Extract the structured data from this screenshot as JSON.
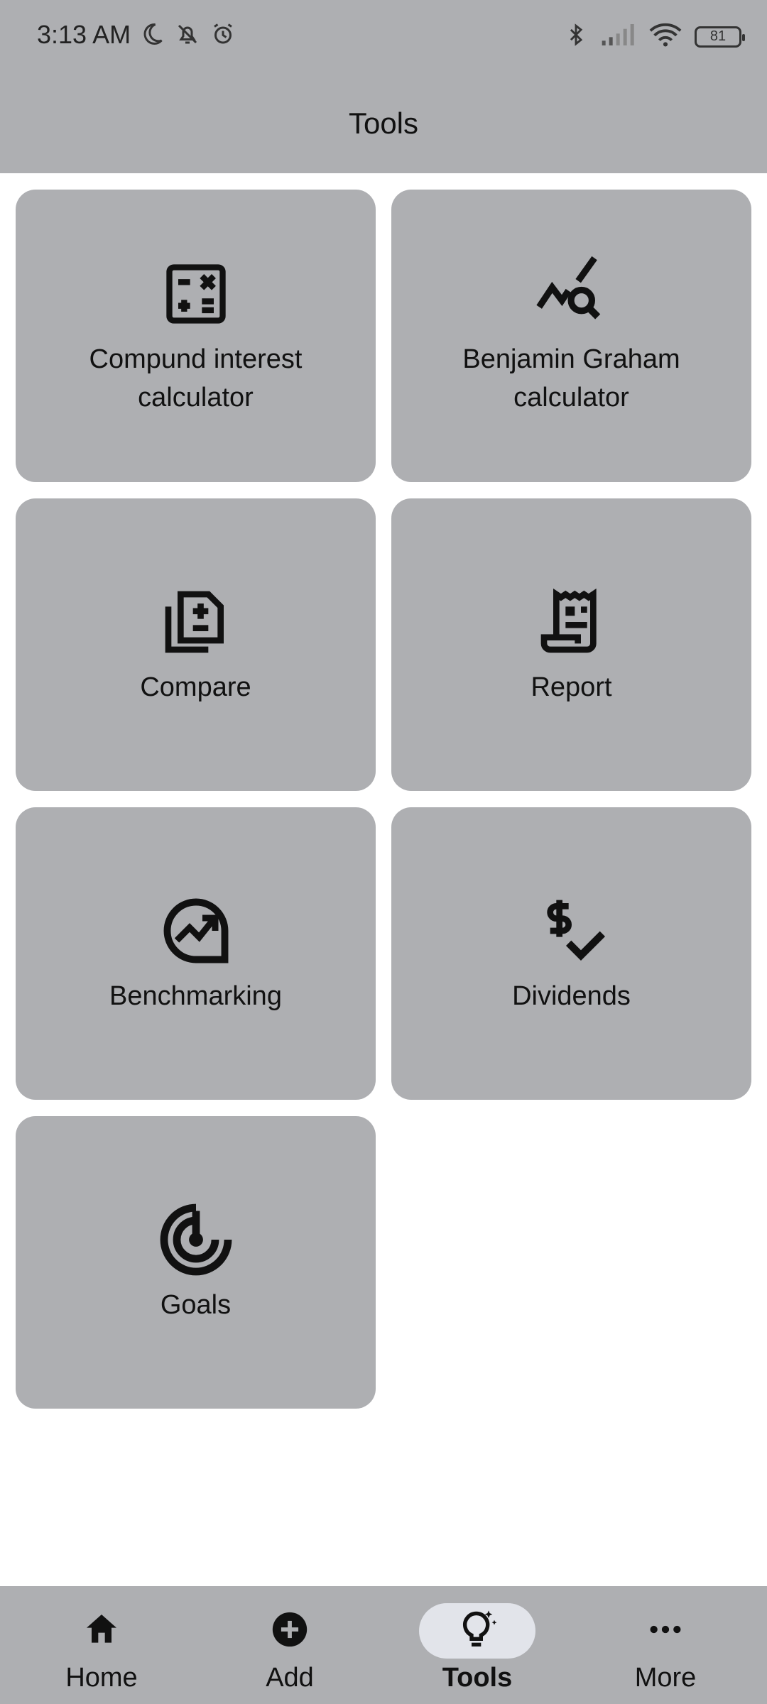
{
  "status_bar": {
    "time": "3:13 AM",
    "battery_level": "81",
    "left_icons": [
      "moon-icon",
      "bell-off-icon",
      "alarm-icon"
    ],
    "right_icons": [
      "bluetooth-icon",
      "signal-icon",
      "wifi-icon",
      "battery-icon"
    ]
  },
  "app_bar": {
    "title": "Tools"
  },
  "tools": [
    {
      "label": "Compund interest calculator",
      "icon": "calculator-icon"
    },
    {
      "label": "Benjamin Graham calculator",
      "icon": "chart-search-icon"
    },
    {
      "label": "Compare",
      "icon": "compare-icon"
    },
    {
      "label": "Report",
      "icon": "receipt-icon"
    },
    {
      "label": "Benchmarking",
      "icon": "benchmark-icon"
    },
    {
      "label": "Dividends",
      "icon": "dividends-icon"
    },
    {
      "label": "Goals",
      "icon": "target-icon"
    }
  ],
  "bottom_nav": {
    "items": [
      {
        "label": "Home",
        "icon": "home-icon",
        "active": false
      },
      {
        "label": "Add",
        "icon": "add-circle-icon",
        "active": false
      },
      {
        "label": "Tools",
        "icon": "lightbulb-icon",
        "active": true
      },
      {
        "label": "More",
        "icon": "more-horizontal-icon",
        "active": false
      }
    ]
  },
  "colors": {
    "surface": "#aeafb2",
    "active_indicator": "#e2e4ea",
    "background": "#ffffff",
    "text": "#111111"
  }
}
